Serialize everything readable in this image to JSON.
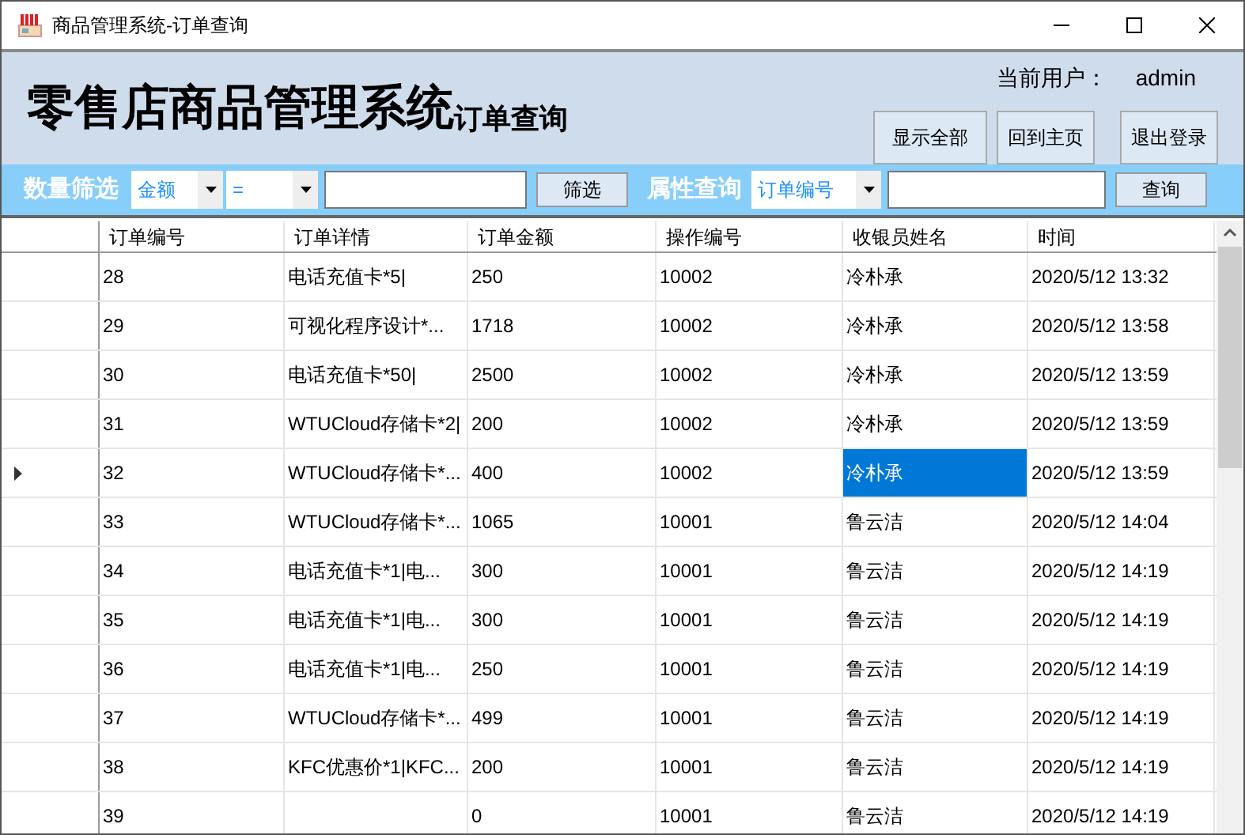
{
  "window": {
    "title": "商品管理系统-订单查询"
  },
  "header": {
    "title": "零售店商品管理系统",
    "subtitle": "订单查询",
    "user_label": "当前用户：",
    "user_name": "admin",
    "buttons": [
      "显示全部",
      "回到主页",
      "退出登录"
    ]
  },
  "filter_bar": {
    "quantity_label": "数量筛选",
    "field_combo": "金额",
    "operator_combo": "=",
    "filter_button": "筛选",
    "attribute_label": "属性查询",
    "attribute_combo": "订单编号",
    "query_button": "查询"
  },
  "table": {
    "columns": [
      "订单编号",
      "订单详情",
      "订单金额",
      "操作编号",
      "收银员姓名",
      "时间"
    ],
    "rows": [
      {
        "order_no": "28",
        "detail": "电话充值卡*5|",
        "amount": "250",
        "operator_no": "10002",
        "cashier": "冷朴承",
        "time": "2020/5/12 13:32",
        "current": false,
        "cashier_selected": false
      },
      {
        "order_no": "29",
        "detail": "可视化程序设计*...",
        "amount": "1718",
        "operator_no": "10002",
        "cashier": "冷朴承",
        "time": "2020/5/12 13:58",
        "current": false,
        "cashier_selected": false
      },
      {
        "order_no": "30",
        "detail": "电话充值卡*50|",
        "amount": "2500",
        "operator_no": "10002",
        "cashier": "冷朴承",
        "time": "2020/5/12 13:59",
        "current": false,
        "cashier_selected": false
      },
      {
        "order_no": "31",
        "detail": "WTUCloud存储卡*2|",
        "amount": "200",
        "operator_no": "10002",
        "cashier": "冷朴承",
        "time": "2020/5/12 13:59",
        "current": false,
        "cashier_selected": false
      },
      {
        "order_no": "32",
        "detail": "WTUCloud存储卡*...",
        "amount": "400",
        "operator_no": "10002",
        "cashier": "冷朴承",
        "time": "2020/5/12 13:59",
        "current": true,
        "cashier_selected": true
      },
      {
        "order_no": "33",
        "detail": "WTUCloud存储卡*...",
        "amount": "1065",
        "operator_no": "10001",
        "cashier": "鲁云洁",
        "time": "2020/5/12 14:04",
        "current": false,
        "cashier_selected": false
      },
      {
        "order_no": "34",
        "detail": "电话充值卡*1|电...",
        "amount": "300",
        "operator_no": "10001",
        "cashier": "鲁云洁",
        "time": "2020/5/12 14:19",
        "current": false,
        "cashier_selected": false
      },
      {
        "order_no": "35",
        "detail": "电话充值卡*1|电...",
        "amount": "300",
        "operator_no": "10001",
        "cashier": "鲁云洁",
        "time": "2020/5/12 14:19",
        "current": false,
        "cashier_selected": false
      },
      {
        "order_no": "36",
        "detail": "电话充值卡*1|电...",
        "amount": "250",
        "operator_no": "10001",
        "cashier": "鲁云洁",
        "time": "2020/5/12 14:19",
        "current": false,
        "cashier_selected": false
      },
      {
        "order_no": "37",
        "detail": "WTUCloud存储卡*...",
        "amount": "499",
        "operator_no": "10001",
        "cashier": "鲁云洁",
        "time": "2020/5/12 14:19",
        "current": false,
        "cashier_selected": false
      },
      {
        "order_no": "38",
        "detail": "KFC优惠价*1|KFC...",
        "amount": "200",
        "operator_no": "10001",
        "cashier": "鲁云洁",
        "time": "2020/5/12 14:19",
        "current": false,
        "cashier_selected": false
      },
      {
        "order_no": "39",
        "amount": "0",
        "operator_no": "10001",
        "cashier": "鲁云洁",
        "time": "2020/5/12 14:19",
        "current": false,
        "cashier_selected": false
      }
    ]
  }
}
